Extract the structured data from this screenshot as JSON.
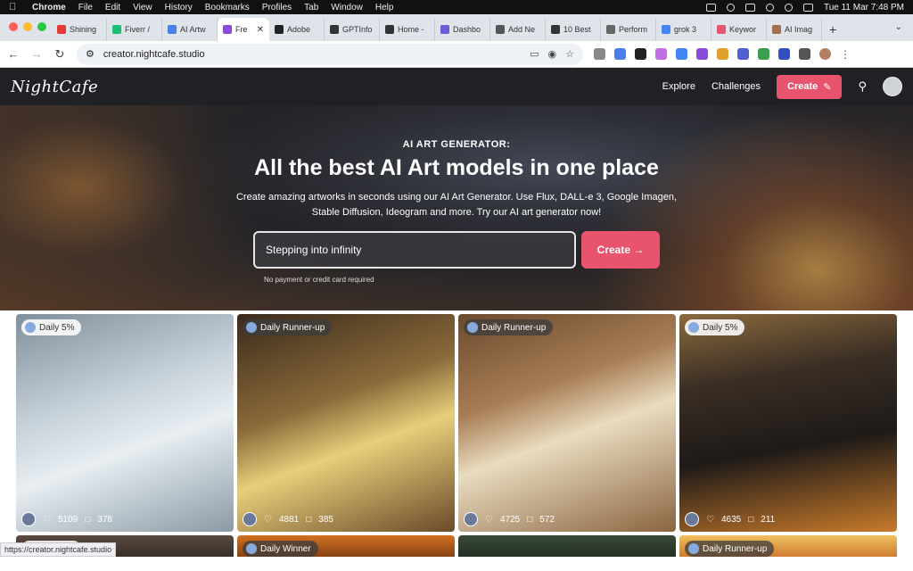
{
  "menubar": {
    "app": "Chrome",
    "items": [
      "File",
      "Edit",
      "View",
      "History",
      "Bookmarks",
      "Profiles",
      "Tab",
      "Window",
      "Help"
    ],
    "clock": "Tue 11 Mar  7:48 PM"
  },
  "tabs": [
    {
      "label": "Shining",
      "color": "#e53935"
    },
    {
      "label": "Fiverr /",
      "color": "#1dbf73"
    },
    {
      "label": "AI Artw",
      "color": "#4a7ee8"
    },
    {
      "label": "Fre",
      "color": "#8a4bd6",
      "active": true
    },
    {
      "label": "Adobe",
      "color": "#222"
    },
    {
      "label": "GPTInfo",
      "color": "#333"
    },
    {
      "label": "Home -",
      "color": "#333"
    },
    {
      "label": "Dashbo",
      "color": "#6b5bd6"
    },
    {
      "label": "Add Ne",
      "color": "#555"
    },
    {
      "label": "10 Best",
      "color": "#333"
    },
    {
      "label": "Perform",
      "color": "#666"
    },
    {
      "label": "grok 3",
      "color": "#4285f4"
    },
    {
      "label": "Keywor",
      "color": "#e8546d"
    },
    {
      "label": "AI Imag",
      "color": "#a07050"
    }
  ],
  "address": {
    "url": "creator.nightcafe.studio"
  },
  "site": {
    "logo": "NightCafe",
    "nav": {
      "explore": "Explore",
      "challenges": "Challenges",
      "create": "Create"
    }
  },
  "hero": {
    "kicker": "AI ART GENERATOR:",
    "headline": "All the best AI Art models in one place",
    "sub": "Create amazing artworks in seconds using our AI Art Generator. Use Flux, DALL-e 3, Google Imagen, Stable Diffusion, Ideogram and more. Try our AI art generator now!",
    "prompt": "Stepping into infinity",
    "button": "Create →",
    "note": "No payment or credit card required"
  },
  "cards": [
    {
      "badge": "Daily 5%",
      "likes": "5109",
      "comments": "378",
      "bg": "linear-gradient(160deg,#7f8f9c 0%,#c9d3db 40%,#e8eef2 60%,#8a9aa6 100%)",
      "dark": false
    },
    {
      "badge": "Daily Runner-up",
      "likes": "4881",
      "comments": "385",
      "bg": "linear-gradient(160deg,#3a2a1c 0%,#8a6a3a 40%,#e6cf7a 60%,#6b4a2a 100%)",
      "dark": true
    },
    {
      "badge": "Daily Runner-up",
      "likes": "4725",
      "comments": "572",
      "bg": "linear-gradient(160deg,#6a4a2e 0%,#a87d55 35%,#e9dcc0 55%,#8a6440 100%)",
      "dark": true
    },
    {
      "badge": "Daily 5%",
      "likes": "4635",
      "comments": "211",
      "bg": "linear-gradient(170deg,#8a6a3e 0%,#3a2e24 30%,#1e1a18 60%,#c87a2a 100%)",
      "dark": false
    },
    {
      "badge": "Daily 5%",
      "bg": "linear-gradient(180deg,#5a4a40,#2a2420)",
      "dark": false
    },
    {
      "badge": "Daily Winner",
      "bg": "linear-gradient(180deg,#d07020,#6a3010)",
      "dark": true
    },
    {
      "badge": "",
      "bg": "linear-gradient(180deg,#3a4a3a,#1a241a)",
      "dark": false
    },
    {
      "badge": "Daily Runner-up",
      "bg": "linear-gradient(180deg,#f0c060,#c06020)",
      "dark": true
    }
  ],
  "statusbar": "https://creator.nightcafe.studio"
}
